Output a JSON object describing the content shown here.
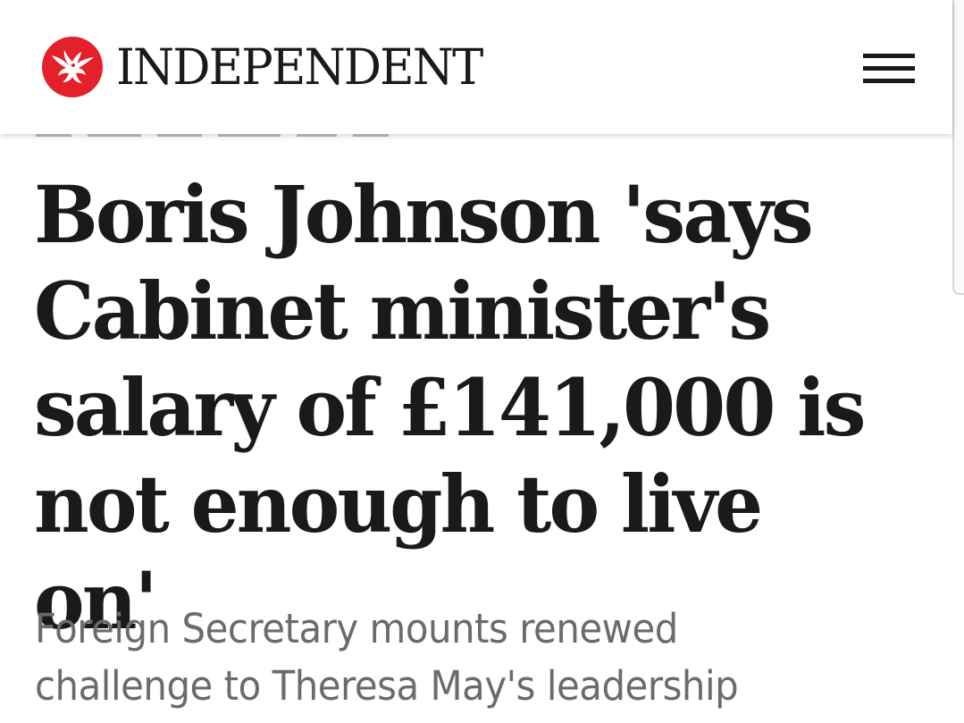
{
  "header": {
    "brand": "INDEPENDENT",
    "logo_icon": "eagle-logo-icon",
    "menu_icon": "hamburger-menu-icon",
    "brand_color": "#e4202a"
  },
  "article": {
    "headline": "Boris Johnson 'says Cabinet minister's salary of £141,000 is not enough to live on'",
    "standfirst": "Foreign Secretary mounts renewed challenge to Theresa May's leadership"
  }
}
